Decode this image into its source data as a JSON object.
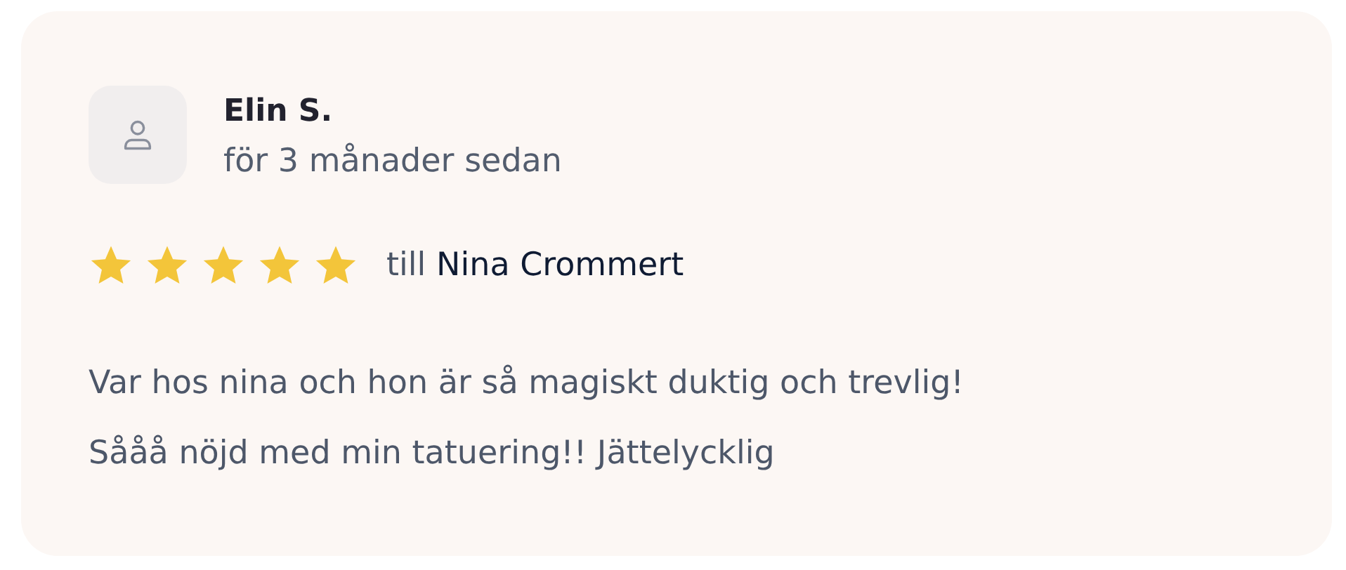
{
  "review": {
    "author": "Elin S.",
    "time": "för 3 månader sedan",
    "stars": 5,
    "to_prefix": "till",
    "recipient": "Nina Crommert",
    "text": "Var hos nina och hon är så magiskt duktig och trevlig!\nSååå nöjd med min tatuering!! Jättelycklig"
  }
}
